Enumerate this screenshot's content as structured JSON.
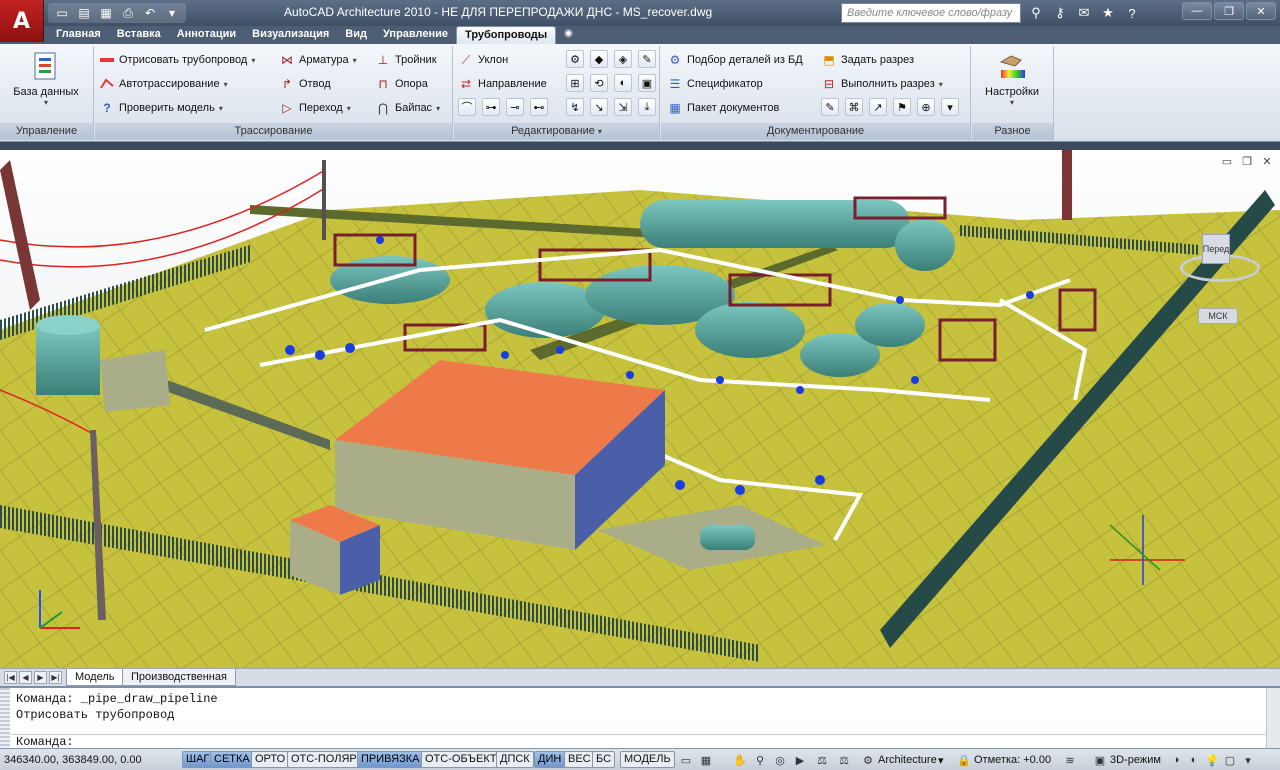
{
  "window": {
    "title": "AutoCAD Architecture 2010 - НЕ ДЛЯ ПЕРЕПРОДАЖИ    ДНС - MS_recover.dwg",
    "logo_letter": "A",
    "search_placeholder": "Введите ключевое слово/фразу"
  },
  "ribbon_tabs": [
    {
      "label": "Главная",
      "active": false
    },
    {
      "label": "Вставка",
      "active": false
    },
    {
      "label": "Аннотации",
      "active": false
    },
    {
      "label": "Визуализация",
      "active": false
    },
    {
      "label": "Вид",
      "active": false
    },
    {
      "label": "Управление",
      "active": false
    },
    {
      "label": "Трубопроводы",
      "active": true
    }
  ],
  "ribbon": {
    "management": {
      "title": "Управление",
      "database_label": "База данных"
    },
    "tracing": {
      "title": "Трассирование",
      "draw_pipeline": "Отрисовать трубопровод",
      "autotrace": "Автотрассирование",
      "check_model": "Проверить модель",
      "fittings": "Арматура",
      "elbow": "Отвод",
      "transition": "Переход",
      "tee": "Тройник",
      "support": "Опора",
      "bypass": "Байпас"
    },
    "editing": {
      "title": "Редактирование",
      "slope": "Уклон",
      "direction": "Направление"
    },
    "documentation": {
      "title": "Документирование",
      "select_parts": "Подбор деталей из БД",
      "specification": "Спецификатор",
      "doc_package": "Пакет документов",
      "set_section": "Задать разрез",
      "make_section": "Выполнить разрез"
    },
    "misc": {
      "title": "Разное",
      "settings": "Настройки"
    }
  },
  "viewport": {
    "viewcube_face": "Перед",
    "wcs_label": "МСК"
  },
  "layout_tabs": [
    {
      "label": "Модель",
      "active": true
    },
    {
      "label": "Производственная",
      "active": false
    }
  ],
  "command_line": {
    "history": [
      "Команда:  _pipe_draw_pipeline",
      "Отрисовать трубопровод"
    ],
    "prompt": "Команда:"
  },
  "statusbar": {
    "coords": "346340.00, 363849.00, 0.00",
    "toggles": [
      {
        "label": "ШАГ",
        "on": true
      },
      {
        "label": "СЕТКА",
        "on": true
      },
      {
        "label": "ОРТО",
        "on": false
      },
      {
        "label": "ОТС-ПОЛЯР",
        "on": false
      },
      {
        "label": "ПРИВЯЗКА",
        "on": true
      },
      {
        "label": "ОТС-ОБЪЕКТ",
        "on": false
      },
      {
        "label": "ДПСК",
        "on": false
      },
      {
        "label": "ДИН",
        "on": true
      },
      {
        "label": "ВЕС",
        "on": false
      },
      {
        "label": "БС",
        "on": false
      }
    ],
    "model_label": "МОДЕЛЬ",
    "workspace": "Architecture",
    "elevation": "Отметка: +0.00",
    "visual_mode": "3D-режим"
  },
  "colors": {
    "ground": "#c6c23e",
    "vessel": "#4f9c96",
    "roof": "#ee7a4a",
    "rack": "#7a1d2e",
    "fence": "#2b4d4a",
    "valve": "#1a3de0"
  }
}
